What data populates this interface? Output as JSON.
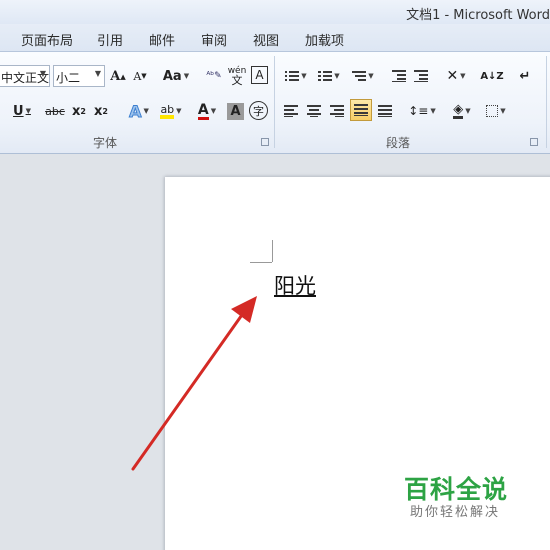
{
  "window": {
    "title": "文档1 - Microsoft Word"
  },
  "menu_tabs": [
    "页面布局",
    "引用",
    "邮件",
    "审阅",
    "视图",
    "加载项"
  ],
  "font_group": {
    "label": "字体",
    "font_name": "中文正文",
    "font_size": "小二",
    "grow_font": "A",
    "shrink_font": "A",
    "change_case": "Aa",
    "phonetic": "wén",
    "char_border": "A",
    "underline": "U",
    "strikethrough": "abc",
    "subscript": "x",
    "superscript": "x",
    "text_effects": "A",
    "highlight": "ab",
    "font_color": "A",
    "char_shading": "A",
    "enclose_char": "字"
  },
  "paragraph_group": {
    "label": "段落",
    "sort": "A↓Z"
  },
  "document": {
    "text": "阳光"
  },
  "watermark": {
    "title": "百科全说",
    "subtitle": "助你轻松解决"
  },
  "colors": {
    "arrow": "#d42a25",
    "watermark_green": "#2da344",
    "highlight_yellow": "#ffe600",
    "font_red": "#d01010"
  }
}
